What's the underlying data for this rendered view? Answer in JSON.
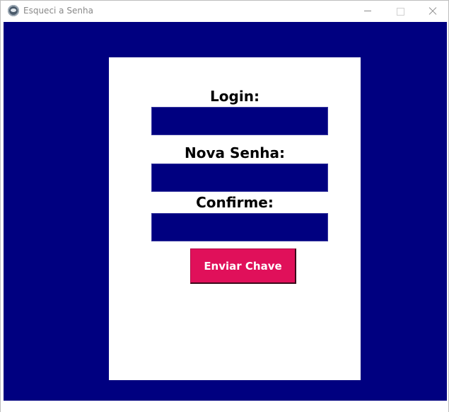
{
  "window": {
    "title": "Esqueci a Senha"
  },
  "form": {
    "login_label": "Login:",
    "login_value": "",
    "new_password_label": "Nova Senha:",
    "new_password_value": "",
    "confirm_label": "Confirme:",
    "confirm_value": "",
    "submit_label": "Enviar Chave"
  },
  "colors": {
    "background": "#000080",
    "panel": "#ffffff",
    "field": "#000080",
    "button": "#e0105a",
    "button_text": "#ffffff"
  },
  "icons": [
    "app-icon",
    "minimize-icon",
    "maximize-icon",
    "close-icon"
  ]
}
